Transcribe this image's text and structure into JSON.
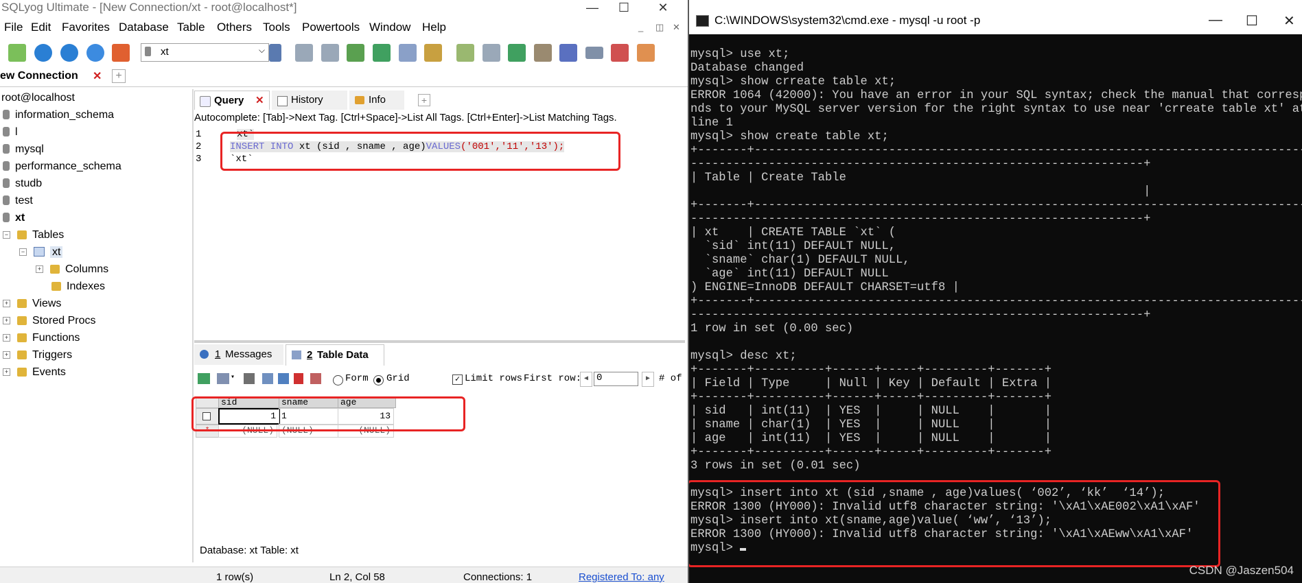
{
  "sqlyog": {
    "title": "SQLyog Ultimate - [New Connection/xt - root@localhost*]",
    "window_buttons": [
      "—",
      "☐",
      "✕"
    ],
    "menu": [
      "File",
      "Edit",
      "Favorites",
      "Database",
      "Table",
      "Others",
      "Tools",
      "Powertools",
      "Window",
      "Help"
    ],
    "mdi_buttons": [
      "_",
      "◫",
      "✕"
    ],
    "db_selector": "xt",
    "connection_tab": "ew Connection",
    "tree": {
      "root": "root@localhost",
      "databases": [
        "information_schema",
        "l",
        "mysql",
        "performance_schema",
        "studb",
        "test",
        "xt"
      ],
      "tables_label": "Tables",
      "table": "xt",
      "columns_label": "Columns",
      "indexes_label": "Indexes",
      "views_label": "Views",
      "procs_label": "Stored Procs",
      "functions_label": "Functions",
      "triggers_label": "Triggers",
      "events_label": "Events"
    },
    "query_tabs": [
      "Query",
      "History",
      "Info"
    ],
    "autocomplete": "Autocomplete: [Tab]->Next Tag. [Ctrl+Space]->List All Tags. [Ctrl+Enter]->List Matching Tags.",
    "editor": {
      "line_numbers": [
        "1",
        "2",
        "3"
      ],
      "line1": "xt`",
      "line2": {
        "kw1": "INSERT INTO",
        "mid": " xt (sid , sname , age)",
        "kw2": "VALUES",
        "vals": "('001','11','13');"
      },
      "line3": "`xt`"
    },
    "result_tabs": {
      "messages_num": "1",
      "messages": "Messages",
      "data_num": "2",
      "data": "Table Data"
    },
    "result_toolbar": {
      "form": "Form",
      "grid": "Grid",
      "limit_rows": "Limit rows",
      "first_row_label": "First row:",
      "first_row_value": "0",
      "num_of": "# of"
    },
    "grid": {
      "headers": [
        "sid",
        "sname",
        "age"
      ],
      "rows": [
        [
          "1",
          "1",
          "13"
        ],
        [
          "(NULL)",
          "(NULL)",
          "(NULL)"
        ]
      ]
    },
    "db_info": "Database: xt Table: xt",
    "status": {
      "rows": "1 row(s)",
      "position": "Ln 2, Col 58",
      "connections": "Connections: 1",
      "registered": "Registered To: any"
    }
  },
  "cmd": {
    "title": "C:\\WINDOWS\\system32\\cmd.exe - mysql  -u root -p",
    "window_buttons": [
      "—",
      "☐",
      "✕"
    ],
    "lines": [
      "mysql> use xt;",
      "Database changed",
      "mysql> show crreate table xt;",
      "ERROR 1064 (42000): You have an error in your SQL syntax; check the manual that correspo",
      "nds to your MySQL server version for the right syntax to use near 'crreate table xt' at",
      "line 1",
      "mysql> show create table xt;",
      "+-------+------------------------------------------------------------------------------",
      "----------------------------------------------------------------+",
      "| Table | Create Table",
      "                                                                |",
      "+-------+------------------------------------------------------------------------------",
      "----------------------------------------------------------------+",
      "| xt    | CREATE TABLE `xt` (",
      "  `sid` int(11) DEFAULT NULL,",
      "  `sname` char(1) DEFAULT NULL,",
      "  `age` int(11) DEFAULT NULL",
      ") ENGINE=InnoDB DEFAULT CHARSET=utf8 |",
      "+-------+------------------------------------------------------------------------------",
      "----------------------------------------------------------------+",
      "1 row in set (0.00 sec)",
      "",
      "mysql> desc xt;",
      "+-------+----------+------+-----+---------+-------+",
      "| Field | Type     | Null | Key | Default | Extra |",
      "+-------+----------+------+-----+---------+-------+",
      "| sid   | int(11)  | YES  |     | NULL    |       |",
      "| sname | char(1)  | YES  |     | NULL    |       |",
      "| age   | int(11)  | YES  |     | NULL    |       |",
      "+-------+----------+------+-----+---------+-------+",
      "3 rows in set (0.01 sec)",
      "",
      "mysql> insert into xt (sid ,sname , age)values( ‘002’, ‘kk’  ‘14’);",
      "ERROR 1300 (HY000): Invalid utf8 character string: '\\xA1\\xAE002\\xA1\\xAF'",
      "mysql> insert into xt(sname,age)value( ‘ww’, ‘13’);",
      "ERROR 1300 (HY000): Invalid utf8 character string: '\\xA1\\xAEww\\xA1\\xAF'",
      "mysql> "
    ],
    "watermark": "CSDN @Jaszen504"
  },
  "colors": {
    "highlight_red": "#e82424",
    "terminal_bg": "#0c0c0c",
    "terminal_fg": "#cccccc",
    "keyword": "#6a6ad0",
    "string": "#c00000"
  }
}
